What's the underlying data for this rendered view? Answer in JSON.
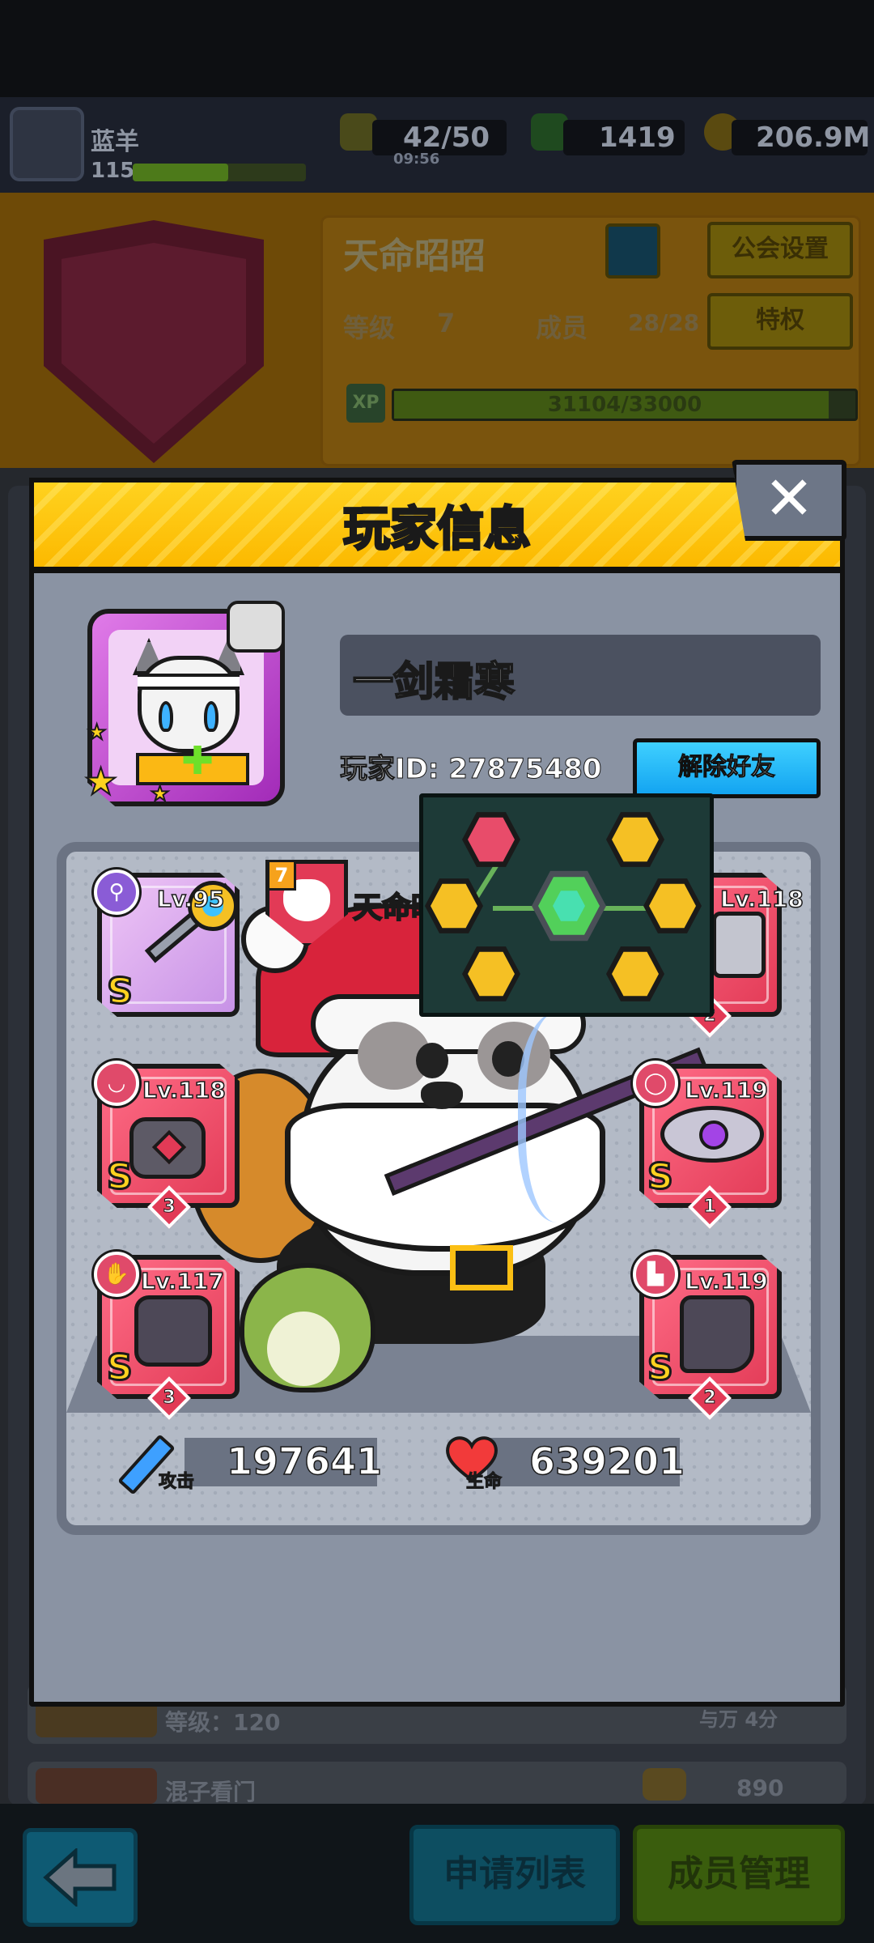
{
  "topbar": {
    "player_name": "蓝羊",
    "player_level": "115",
    "player_xp_fraction": 0.55,
    "energy": "42/50",
    "energy_timer": "09:56",
    "gems": "1419",
    "gold": "206.9M"
  },
  "guild": {
    "name": "天命昭昭",
    "level_label": "等级",
    "level": "7",
    "members_label": "成员",
    "members": "28/28",
    "settings_button": "公会设置",
    "privilege_button": "特权",
    "xp_badge": "XP",
    "xp_text": "31104/33000",
    "xp_fraction": 0.9426
  },
  "list": {
    "row1_text": "等级：120",
    "row1_right": "与万  4分",
    "row2_text": "混子看门",
    "row2_right": "890"
  },
  "bottom_bar": {
    "apply_list": "申请列表",
    "member_manage": "成员管理"
  },
  "modal": {
    "title": "玩家信息",
    "close_glyph": "✕",
    "player_name": "一剑霜寒",
    "player_id": "玩家ID: 27875480",
    "unfriend_button": "解除好友",
    "guild_tag_level": "7",
    "guild_tag_name": "天命昭",
    "equipment": [
      {
        "slot": "weapon",
        "level": "Lv.95",
        "count": ""
      },
      {
        "slot": "armor",
        "level": "Lv.118",
        "count": "2"
      },
      {
        "slot": "necklace",
        "level": "Lv.118",
        "count": "3"
      },
      {
        "slot": "ring",
        "level": "Lv.119",
        "count": "1"
      },
      {
        "slot": "gloves",
        "level": "Lv.117",
        "count": "3"
      },
      {
        "slot": "boots",
        "level": "Lv.119",
        "count": "2"
      }
    ],
    "grade": "S",
    "attack_caption": "攻击",
    "attack_value": "197641",
    "hp_caption": "生命",
    "hp_value": "639201"
  },
  "colors": {
    "header_yellow": "#fcb900",
    "slot_red": "#e23a56",
    "slot_purple": "#c792e6",
    "unfriend_blue": "#13a4f1",
    "modal_bg": "#8a93a3"
  }
}
